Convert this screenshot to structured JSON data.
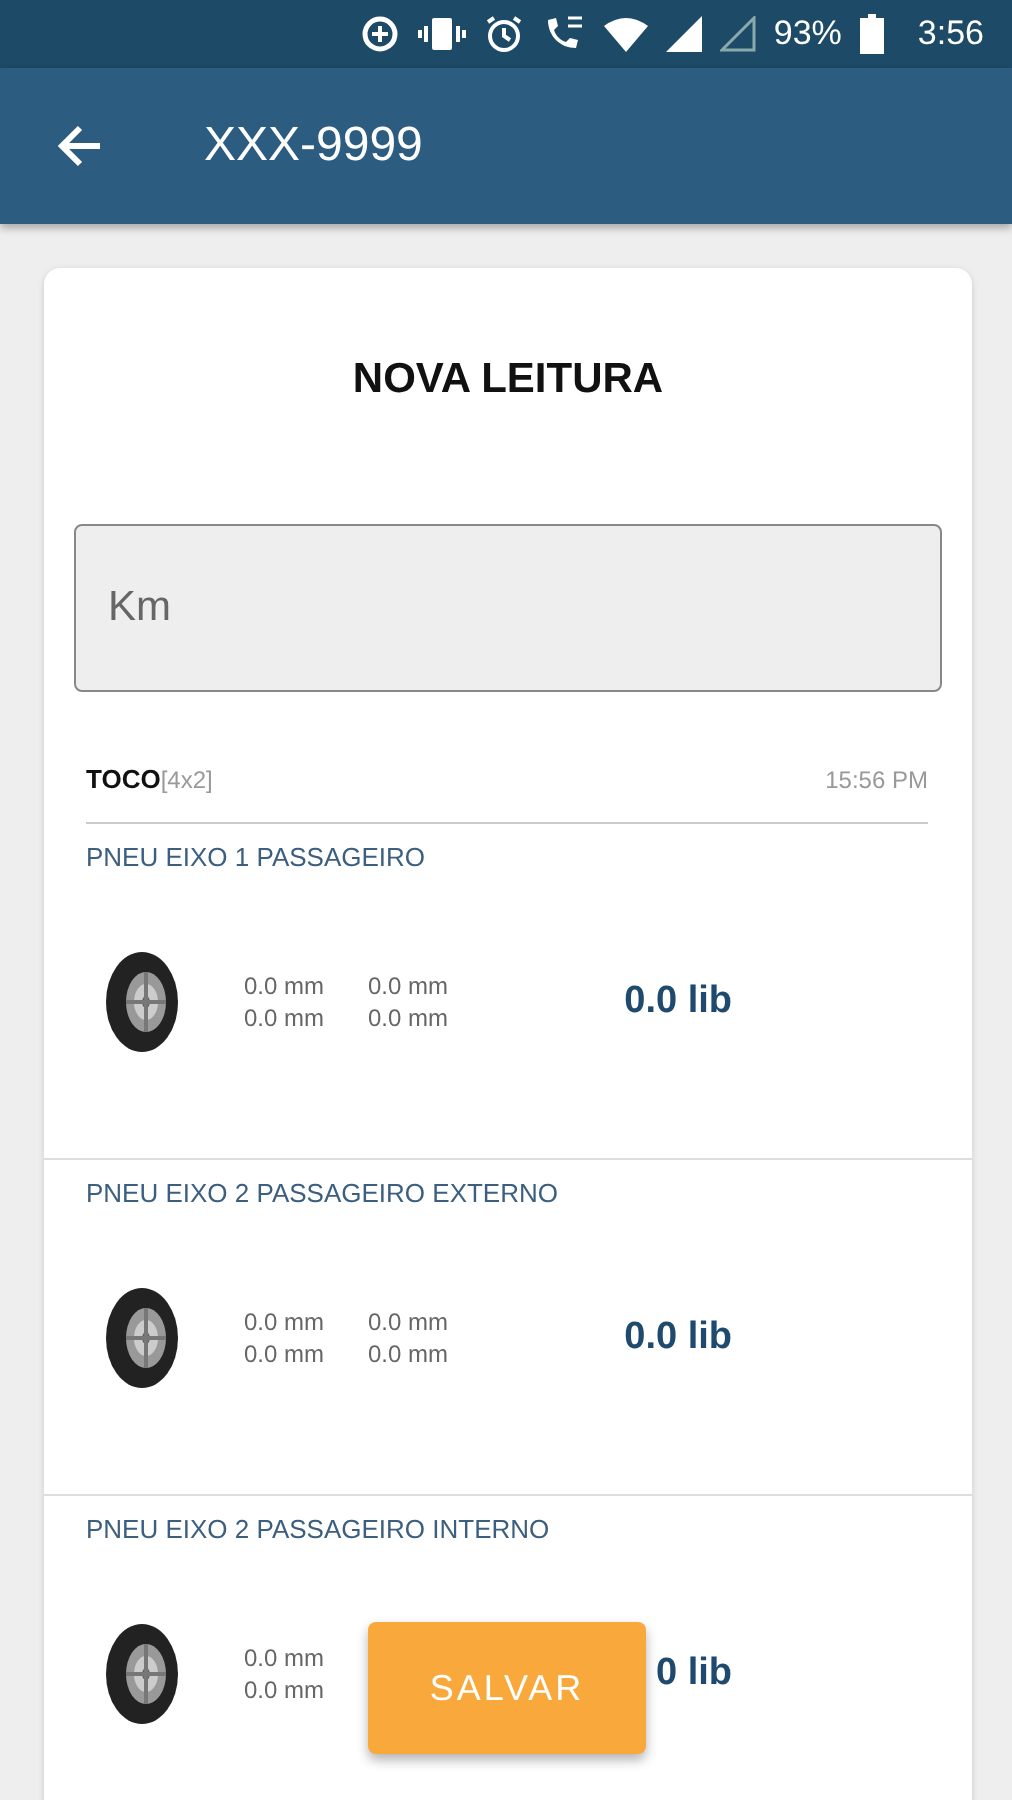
{
  "status_bar": {
    "battery_text": "93%",
    "time": "3:56"
  },
  "app_bar": {
    "title": "XXX-9999"
  },
  "card": {
    "title": "NOVA LEITURA",
    "km_field": {
      "placeholder": "Km"
    },
    "vehicle": {
      "name": "TOCO",
      "config": "[4x2]",
      "time": "15:56 PM"
    },
    "tires": [
      {
        "label": "PNEU EIXO 1 PASSAGEIRO",
        "depths_left": [
          "0.0 mm",
          "0.0 mm"
        ],
        "depths_right": [
          "0.0 mm",
          "0.0 mm"
        ],
        "pressure": "0.0 lib"
      },
      {
        "label": "PNEU EIXO 2 PASSAGEIRO EXTERNO",
        "depths_left": [
          "0.0 mm",
          "0.0 mm"
        ],
        "depths_right": [
          "0.0 mm",
          "0.0 mm"
        ],
        "pressure": "0.0 lib"
      },
      {
        "label": "PNEU EIXO 2 PASSAGEIRO INTERNO",
        "depths_left": [
          "0.0 mm",
          "0.0 mm"
        ],
        "pressure": "0 lib"
      }
    ]
  },
  "save_button": {
    "label": "SALVAR"
  }
}
